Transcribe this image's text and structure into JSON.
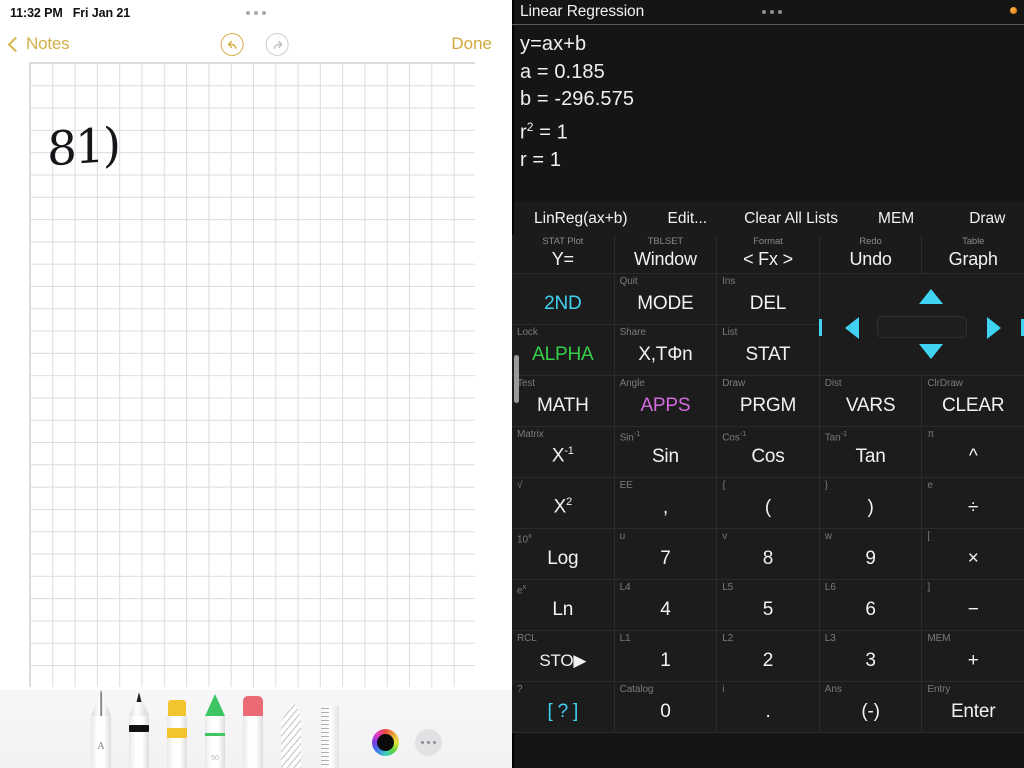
{
  "notes": {
    "status": {
      "time": "11:32 PM",
      "date": "Fri Jan 21"
    },
    "toolbar": {
      "back_label": "Notes",
      "done_label": "Done",
      "undo_icon": "undo-icon",
      "redo_icon": "redo-icon"
    },
    "canvas": {
      "handwriting": "81)"
    },
    "markup_tools": [
      {
        "name": "pencil-tool",
        "glyph": "A"
      },
      {
        "name": "pen-tool",
        "glyph": ""
      },
      {
        "name": "highlighter-tool",
        "glyph": ""
      },
      {
        "name": "marker-tool",
        "glyph": "50"
      },
      {
        "name": "eraser-tool",
        "glyph": ""
      },
      {
        "name": "lasso-tool",
        "glyph": ""
      },
      {
        "name": "ruler-tool",
        "glyph": ""
      }
    ],
    "color_picker": {
      "selected_color": "#0b0b0d"
    },
    "more_label": "more-options"
  },
  "calculator": {
    "title": "Linear Regression",
    "output_lines": [
      {
        "text": "y=ax+b",
        "sup": ""
      },
      {
        "text": "a = 0.185",
        "sup": ""
      },
      {
        "text": "b = -296.575",
        "sup": ""
      },
      {
        "text": "r",
        "sup": "2",
        "tail": " = 1"
      },
      {
        "text": "r = 1",
        "sup": ""
      }
    ],
    "menu": [
      "LinReg(ax+b)",
      "Edit...",
      "Clear All Lists",
      "MEM",
      "Draw"
    ],
    "rows": [
      [
        {
          "sec": "STAT Plot",
          "lab": "Y=",
          "color": ""
        },
        {
          "sec": "TBLSET",
          "lab": "Window",
          "color": ""
        },
        {
          "sec": "Format",
          "lab": "< Fx >",
          "color": ""
        },
        {
          "sec": "Redo",
          "lab": "Undo",
          "color": ""
        },
        {
          "sec": "Table",
          "lab": "Graph",
          "color": ""
        }
      ],
      [
        {
          "sec": "",
          "lab": "2ND",
          "color": "cy"
        },
        {
          "sec": "Quit",
          "lab": "MODE",
          "color": ""
        },
        {
          "sec": "Ins",
          "lab": "DEL",
          "color": ""
        }
      ],
      [
        {
          "sec": "Lock",
          "lab": "ALPHA",
          "color": "gr"
        },
        {
          "sec": "Share",
          "lab": "X,TΦn",
          "color": ""
        },
        {
          "sec": "List",
          "lab": "STAT",
          "color": ""
        }
      ],
      [
        {
          "sec": "Test",
          "lab": "MATH",
          "color": ""
        },
        {
          "sec": "Angle",
          "lab": "APPS",
          "color": "mg"
        },
        {
          "sec": "Draw",
          "lab": "PRGM",
          "color": ""
        },
        {
          "sec": "Dist",
          "lab": "VARS",
          "color": ""
        },
        {
          "sec": "ClrDraw",
          "lab": "CLEAR",
          "color": ""
        }
      ],
      [
        {
          "sec": "Matrix",
          "lab": "X",
          "sup": "-1",
          "color": ""
        },
        {
          "sec": "Sin",
          "secsup": "-1",
          "lab": "Sin",
          "color": ""
        },
        {
          "sec": "Cos",
          "secsup": "-1",
          "lab": "Cos",
          "color": ""
        },
        {
          "sec": "Tan",
          "secsup": "-1",
          "lab": "Tan",
          "color": ""
        },
        {
          "sec": "π",
          "lab": "^",
          "color": ""
        }
      ],
      [
        {
          "sec": "√",
          "lab": "X",
          "sup": "2",
          "color": ""
        },
        {
          "sec": "EE",
          "lab": ",",
          "color": ""
        },
        {
          "sec": "{",
          "lab": "(",
          "color": ""
        },
        {
          "sec": "}",
          "lab": ")",
          "color": ""
        },
        {
          "sec": "e",
          "lab": "÷",
          "color": ""
        }
      ],
      [
        {
          "sec": "10",
          "secsup": "x",
          "lab": "Log",
          "color": ""
        },
        {
          "sec": "u",
          "lab": "7",
          "color": ""
        },
        {
          "sec": "v",
          "lab": "8",
          "color": ""
        },
        {
          "sec": "w",
          "lab": "9",
          "color": ""
        },
        {
          "sec": "[",
          "lab": "×",
          "color": ""
        }
      ],
      [
        {
          "sec": "e",
          "secsup": "x",
          "lab": "Ln",
          "color": ""
        },
        {
          "sec": "L4",
          "lab": "4",
          "color": ""
        },
        {
          "sec": "L5",
          "lab": "5",
          "color": ""
        },
        {
          "sec": "L6",
          "lab": "6",
          "color": ""
        },
        {
          "sec": "]",
          "lab": "−",
          "color": ""
        }
      ],
      [
        {
          "sec": "RCL",
          "lab": "STO▶",
          "color": ""
        },
        {
          "sec": "L1",
          "lab": "1",
          "color": ""
        },
        {
          "sec": "L2",
          "lab": "2",
          "color": ""
        },
        {
          "sec": "L3",
          "lab": "3",
          "color": ""
        },
        {
          "sec": "MEM",
          "lab": "+",
          "color": ""
        }
      ],
      [
        {
          "sec": "?",
          "lab": "[ ? ]",
          "color": "cy"
        },
        {
          "sec": "Catalog",
          "lab": "0",
          "color": ""
        },
        {
          "sec": "i",
          "lab": ".",
          "color": ""
        },
        {
          "sec": "Ans",
          "lab": "(-)",
          "color": ""
        },
        {
          "sec": "Entry",
          "lab": "Enter",
          "color": ""
        }
      ]
    ],
    "dpad": {
      "up": "arrow-up",
      "down": "arrow-down",
      "left": "arrow-left",
      "right": "arrow-right"
    },
    "accent_colors": {
      "second": "#3fd2f2",
      "alpha": "#35d04a",
      "apps": "#d36ae0",
      "arrows": "#3fd2f2"
    }
  }
}
